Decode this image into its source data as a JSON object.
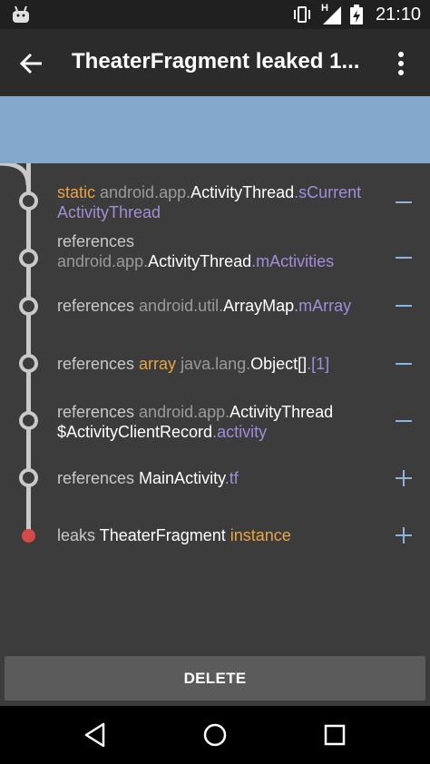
{
  "status_bar": {
    "time": "21:10",
    "network_label": "H"
  },
  "app_bar": {
    "title": "TheaterFragment leaked 1..."
  },
  "trace": [
    {
      "segments": [
        {
          "text": "static ",
          "style": "orange"
        },
        {
          "text": "android.app.",
          "style": "grey"
        },
        {
          "text": "ActivityThread",
          "style": "white"
        },
        {
          "text": ".sCurrent",
          "style": "purple"
        },
        {
          "text": "ActivityThread",
          "style": "purple"
        }
      ],
      "action": "collapse"
    },
    {
      "segments": [
        {
          "text": "references",
          "style": "normal"
        },
        {
          "text": "android.app.",
          "style": "grey"
        },
        {
          "text": "ActivityThread",
          "style": "white"
        },
        {
          "text": ".mActivities",
          "style": "purple"
        }
      ],
      "action": "collapse"
    },
    {
      "segments": [
        {
          "text": "references ",
          "style": "normal"
        },
        {
          "text": "android.util.",
          "style": "grey"
        },
        {
          "text": "ArrayMap",
          "style": "white"
        },
        {
          "text": ".mArray",
          "style": "purple"
        }
      ],
      "action": "collapse"
    },
    {
      "segments": [
        {
          "text": "references ",
          "style": "normal"
        },
        {
          "text": "array ",
          "style": "orange"
        },
        {
          "text": "java.lang.",
          "style": "grey"
        },
        {
          "text": "Object[]",
          "style": "white"
        },
        {
          "text": ".[1]",
          "style": "purple"
        }
      ],
      "action": "collapse"
    },
    {
      "segments": [
        {
          "text": "references ",
          "style": "normal"
        },
        {
          "text": "android.app.",
          "style": "grey"
        },
        {
          "text": "ActivityThread",
          "style": "white"
        },
        {
          "text": "$ActivityClientRecord",
          "style": "white"
        },
        {
          "text": ".activity",
          "style": "purple"
        }
      ],
      "action": "collapse"
    },
    {
      "segments": [
        {
          "text": "references ",
          "style": "normal"
        },
        {
          "text": "MainActivity",
          "style": "white"
        },
        {
          "text": ".tf",
          "style": "purple"
        }
      ],
      "action": "expand"
    },
    {
      "segments": [
        {
          "text": "leaks ",
          "style": "normal"
        },
        {
          "text": "TheaterFragment ",
          "style": "white"
        },
        {
          "text": "instance",
          "style": "orange"
        }
      ],
      "action": "expand"
    }
  ],
  "delete_button": {
    "label": "DELETE"
  },
  "colors": {
    "accent_blue": "#83a8cb",
    "leak_red": "#d44a4a",
    "orange": "#e8a44a",
    "purple": "#9e8fd6"
  },
  "icons": {
    "back": "arrow-back-icon",
    "overflow": "more-vert-icon",
    "collapse": "minus-icon",
    "expand": "plus-icon",
    "nav_back": "nav-back-icon",
    "nav_home": "nav-home-icon",
    "nav_recents": "nav-recents-icon"
  }
}
